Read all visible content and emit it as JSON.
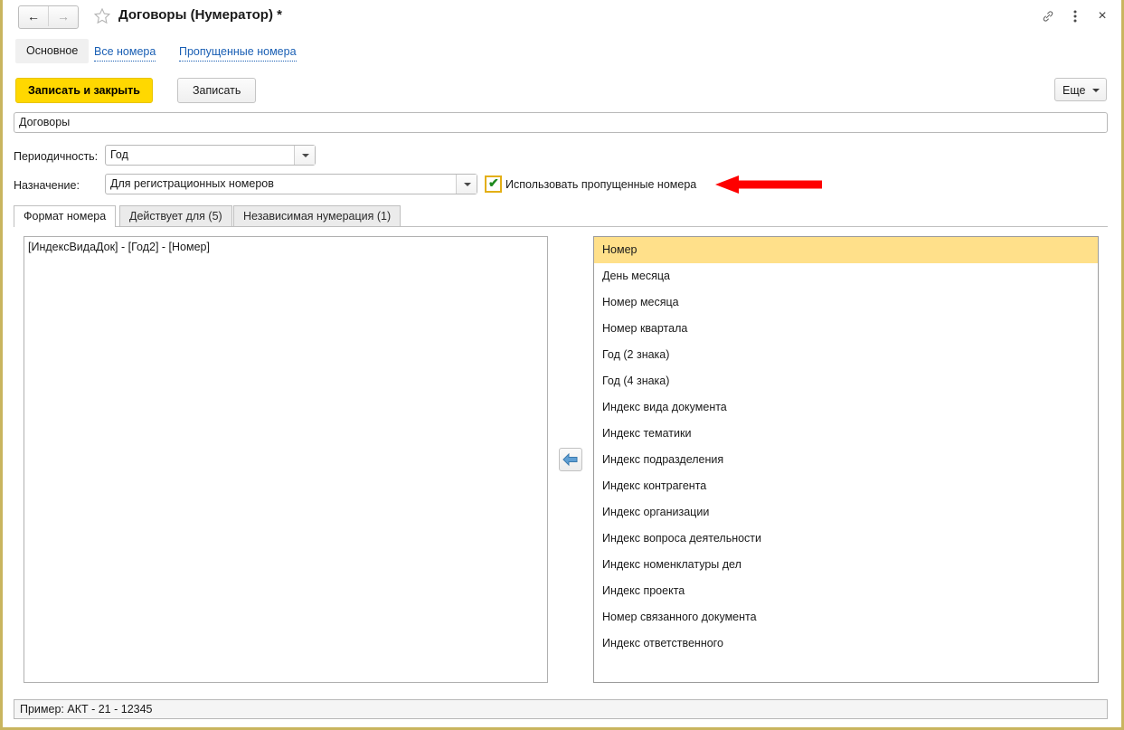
{
  "window": {
    "title": "Договоры (Нумератор) *",
    "nav": {
      "back": "←",
      "forward": "→"
    },
    "icons": {
      "star": "star-icon",
      "link": "link-icon",
      "menu": "kebab-menu-icon",
      "close": "×"
    }
  },
  "top_tabs": [
    {
      "label": "Основное",
      "active": true
    },
    {
      "label": "Все номера",
      "active": false
    },
    {
      "label": "Пропущенные номера",
      "active": false
    }
  ],
  "command_bar": {
    "save_and_close": "Записать и закрыть",
    "save": "Записать",
    "more": "Еще"
  },
  "form": {
    "name_value": "Договоры",
    "periodicity_label": "Периодичность:",
    "periodicity_value": "Год",
    "purpose_label": "Назначение:",
    "purpose_value": "Для регистрационных номеров",
    "use_skipped_label": "Использовать пропущенные номера",
    "use_skipped_checked": true,
    "checkmark": "✔"
  },
  "inner_tabs": [
    {
      "label": "Формат номера",
      "active": true
    },
    {
      "label": "Действует для (5)",
      "active": false
    },
    {
      "label": "Независимая нумерация (1)",
      "active": false
    }
  ],
  "format_editor": {
    "text": "[ИндексВидаДок] - [Год2] - [Номер]"
  },
  "transfer_button": {
    "icon": "arrow-left-icon"
  },
  "tokens": [
    {
      "label": "Номер",
      "selected": true
    },
    {
      "label": "День месяца",
      "selected": false
    },
    {
      "label": "Номер месяца",
      "selected": false
    },
    {
      "label": "Номер квартала",
      "selected": false
    },
    {
      "label": "Год (2 знака)",
      "selected": false
    },
    {
      "label": "Год (4 знака)",
      "selected": false
    },
    {
      "label": "Индекс вида документа",
      "selected": false
    },
    {
      "label": "Индекс тематики",
      "selected": false
    },
    {
      "label": "Индекс подразделения",
      "selected": false
    },
    {
      "label": "Индекс контрагента",
      "selected": false
    },
    {
      "label": "Индекс организации",
      "selected": false
    },
    {
      "label": "Индекс вопроса деятельности",
      "selected": false
    },
    {
      "label": "Индекс номенклатуры дел",
      "selected": false
    },
    {
      "label": "Индекс проекта",
      "selected": false
    },
    {
      "label": "Номер связанного документа",
      "selected": false
    },
    {
      "label": "Индекс ответственного",
      "selected": false
    }
  ],
  "status_bar": {
    "text": "Пример: АКТ - 21 - 12345"
  },
  "colors": {
    "window_border": "#c9b55f",
    "primary_button": "#ffd800",
    "selection": "#ffe08a",
    "link": "#1a5fb4",
    "checkbox_border": "#e3af16",
    "checkmark": "#1e8a1e",
    "annotation_arrow": "#fe0000"
  }
}
